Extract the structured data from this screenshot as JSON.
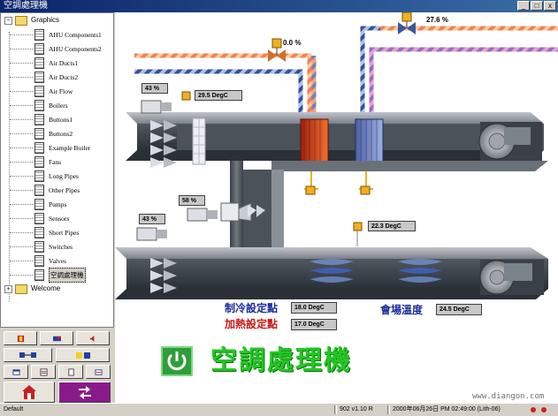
{
  "window": {
    "title": "空調處理機"
  },
  "tree": {
    "root_label": "Graphics",
    "items": [
      "AHU Components1",
      "AHU Components2",
      "Air Ducts1",
      "Air Ducts2",
      "Air Flow",
      "Boilers",
      "Buttons1",
      "Buttons2",
      "Example Boiler",
      "Fans",
      "Long Pipes",
      "Other Pipes",
      "Pumps",
      "Sensors",
      "Short Pipes",
      "Switches",
      "Valves",
      "空調處理機"
    ],
    "selected_index": 17,
    "root2_label": "Welcome"
  },
  "readouts": {
    "valve_top_right": "27.6 %",
    "valve_top_mid": "0.0 %",
    "damper_upper_left": "43 %",
    "temp_upper": "29.5 DegC",
    "damper_mid": "58 %",
    "damper_lower_left": "43 %",
    "temp_lower": "22.3 DegC"
  },
  "setpoints": {
    "cooling_label": "制冷設定點",
    "cooling_value": "18.0 DegC",
    "heating_label": "加熱設定點",
    "heating_value": "17.0 DegC",
    "venue_label": "會場溫度",
    "venue_value": "24.5 DegC"
  },
  "brand": {
    "title": "空調處理機"
  },
  "watermark": "www.diangon.com",
  "status": {
    "left": "Default",
    "version": "902 v1.10 R",
    "datetime": "2000年06月26日 PM 02:49:00 (Lith-06)"
  },
  "colors": {
    "cool_coil": "#3a68b8",
    "heat_coil": "#d0501c",
    "title_green": "#22c822",
    "valve": "#f0b020"
  }
}
